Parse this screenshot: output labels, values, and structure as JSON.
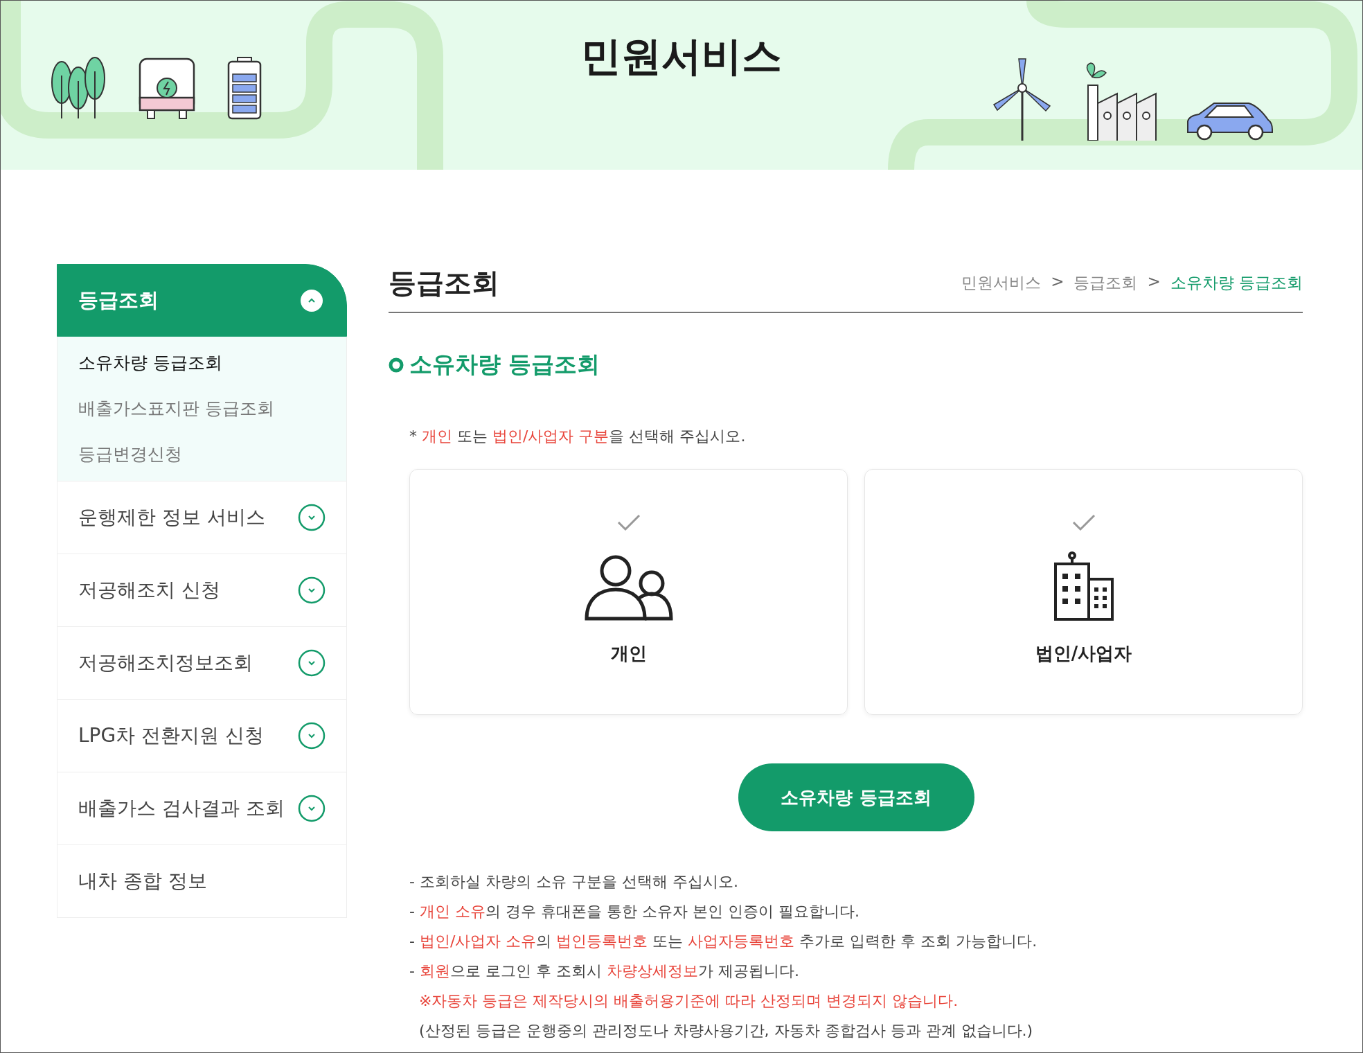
{
  "banner": {
    "title": "민원서비스"
  },
  "sidebar": {
    "items": [
      {
        "kind": "group",
        "label": "등급조회",
        "expanded": true,
        "children": [
          {
            "label": "소유차량 등급조회",
            "selected": true
          },
          {
            "label": "배출가스표지판 등급조회",
            "selected": false
          },
          {
            "label": "등급변경신청",
            "selected": false
          }
        ]
      },
      {
        "kind": "group",
        "label": "운행제한 정보 서비스",
        "expanded": false
      },
      {
        "kind": "group",
        "label": "저공해조치 신청",
        "expanded": false
      },
      {
        "kind": "group",
        "label": "저공해조치정보조회",
        "expanded": false
      },
      {
        "kind": "group",
        "label": "LPG차 전환지원 신청",
        "expanded": false
      },
      {
        "kind": "group",
        "label": "배출가스 검사결과 조회",
        "expanded": false
      },
      {
        "kind": "link",
        "label": "내차 종합 정보"
      }
    ]
  },
  "page": {
    "title": "등급조회",
    "breadcrumb": [
      {
        "label": "민원서비스",
        "selected": false
      },
      {
        "label": "등급조회",
        "selected": false
      },
      {
        "label": "소유차량 등급조회",
        "selected": true
      }
    ],
    "separator": ">"
  },
  "section": {
    "title": "소유차량 등급조회",
    "instruction": [
      {
        "text": "* ",
        "highlight": false
      },
      {
        "text": "개인",
        "highlight": true
      },
      {
        "text": " 또는 ",
        "highlight": false
      },
      {
        "text": "법인/사업자 구분",
        "highlight": true
      },
      {
        "text": "을 선택해 주십시오.",
        "highlight": false
      }
    ],
    "options": [
      {
        "kind": "person",
        "label": "개인",
        "selected": false
      },
      {
        "kind": "company",
        "label": "법인/사업자",
        "selected": false
      }
    ],
    "button": "소유차량 등급조회",
    "notes": [
      [
        {
          "text": "- 조회하실 차량의 소유 구분을 선택해 주십시오.",
          "highlight": false
        }
      ],
      [
        {
          "text": "- ",
          "highlight": false
        },
        {
          "text": "개인 소유",
          "highlight": true
        },
        {
          "text": "의 경우 휴대폰을 통한 소유자 본인 인증이 필요합니다.",
          "highlight": false
        }
      ],
      [
        {
          "text": "- ",
          "highlight": false
        },
        {
          "text": "법인/사업자 소유",
          "highlight": true
        },
        {
          "text": "의 ",
          "highlight": false
        },
        {
          "text": "법인등록번호",
          "highlight": true
        },
        {
          "text": " 또는 ",
          "highlight": false
        },
        {
          "text": "사업자등록번호",
          "highlight": true
        },
        {
          "text": " 추가로 입력한 후 조회 가능합니다.",
          "highlight": false
        }
      ],
      [
        {
          "text": "- ",
          "highlight": false
        },
        {
          "text": "회원",
          "highlight": true
        },
        {
          "text": "으로 로그인 후 조회시 ",
          "highlight": false
        },
        {
          "text": "차량상세정보",
          "highlight": true
        },
        {
          "text": "가 제공됩니다.",
          "highlight": false
        }
      ],
      [
        {
          "text": "  ※자동차 등급은 제작당시의 배출허용기준에 따라 산정되며 변경되지 않습니다.",
          "highlight": true
        }
      ],
      [
        {
          "text": "  (산정된 등급은 운행중의 관리정도나 차량사용기간, 자동차 종합검사 등과 관계 없습니다.)",
          "highlight": false
        }
      ]
    ]
  }
}
